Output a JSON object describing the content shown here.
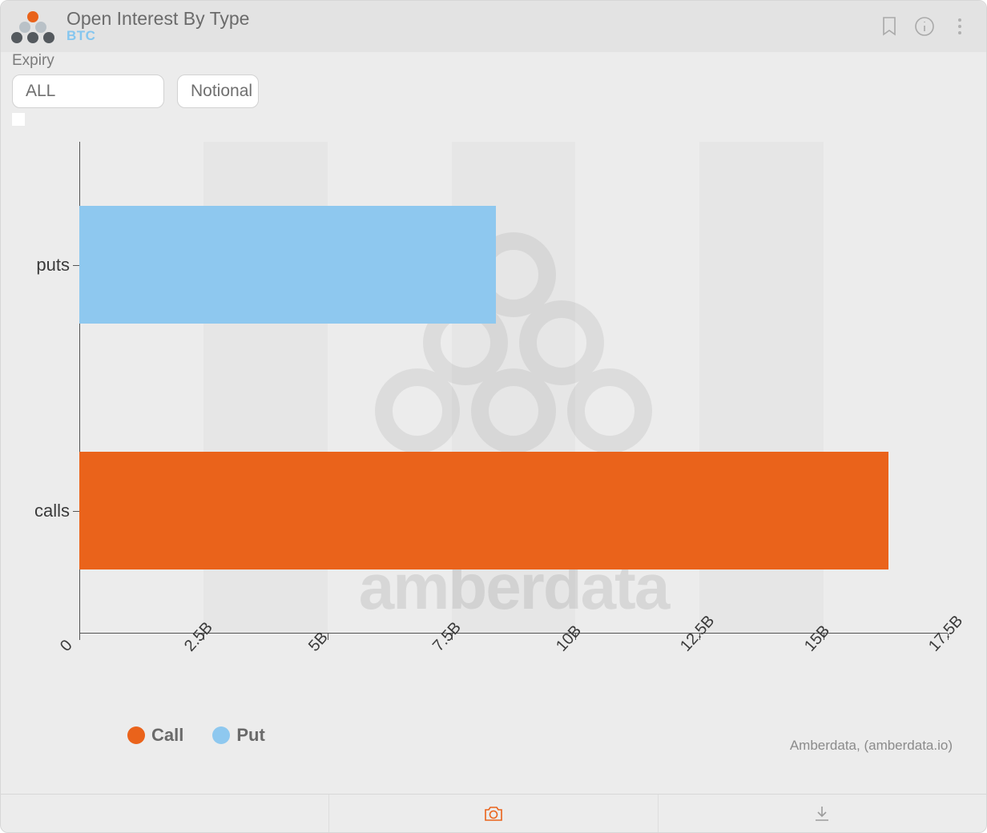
{
  "header": {
    "title": "Open Interest By Type",
    "subtitle": "BTC"
  },
  "controls": {
    "expiry_label": "Expiry",
    "expiry_value": "ALL",
    "mode_value": "Notional"
  },
  "legend": {
    "call": "Call",
    "put": "Put"
  },
  "credit": "Amberdata, (amberdata.io)",
  "chart_data": {
    "type": "bar",
    "orientation": "horizontal",
    "categories": [
      "puts",
      "calls"
    ],
    "series": [
      {
        "name": "Put",
        "color": "#8ec8ef",
        "values": [
          8.4,
          null
        ]
      },
      {
        "name": "Call",
        "color": "#ea631b",
        "values": [
          null,
          16.3
        ]
      }
    ],
    "x_ticks": [
      0,
      2.5,
      5,
      7.5,
      10,
      12.5,
      15,
      17.5
    ],
    "x_tick_labels": [
      "0",
      "2.5B",
      "5B",
      "7.5B",
      "10B",
      "12.5B",
      "15B",
      "17.5B"
    ],
    "xlim": [
      0,
      17.5
    ],
    "xlabel": "",
    "ylabel": "",
    "unit": "B (billions notional)"
  }
}
